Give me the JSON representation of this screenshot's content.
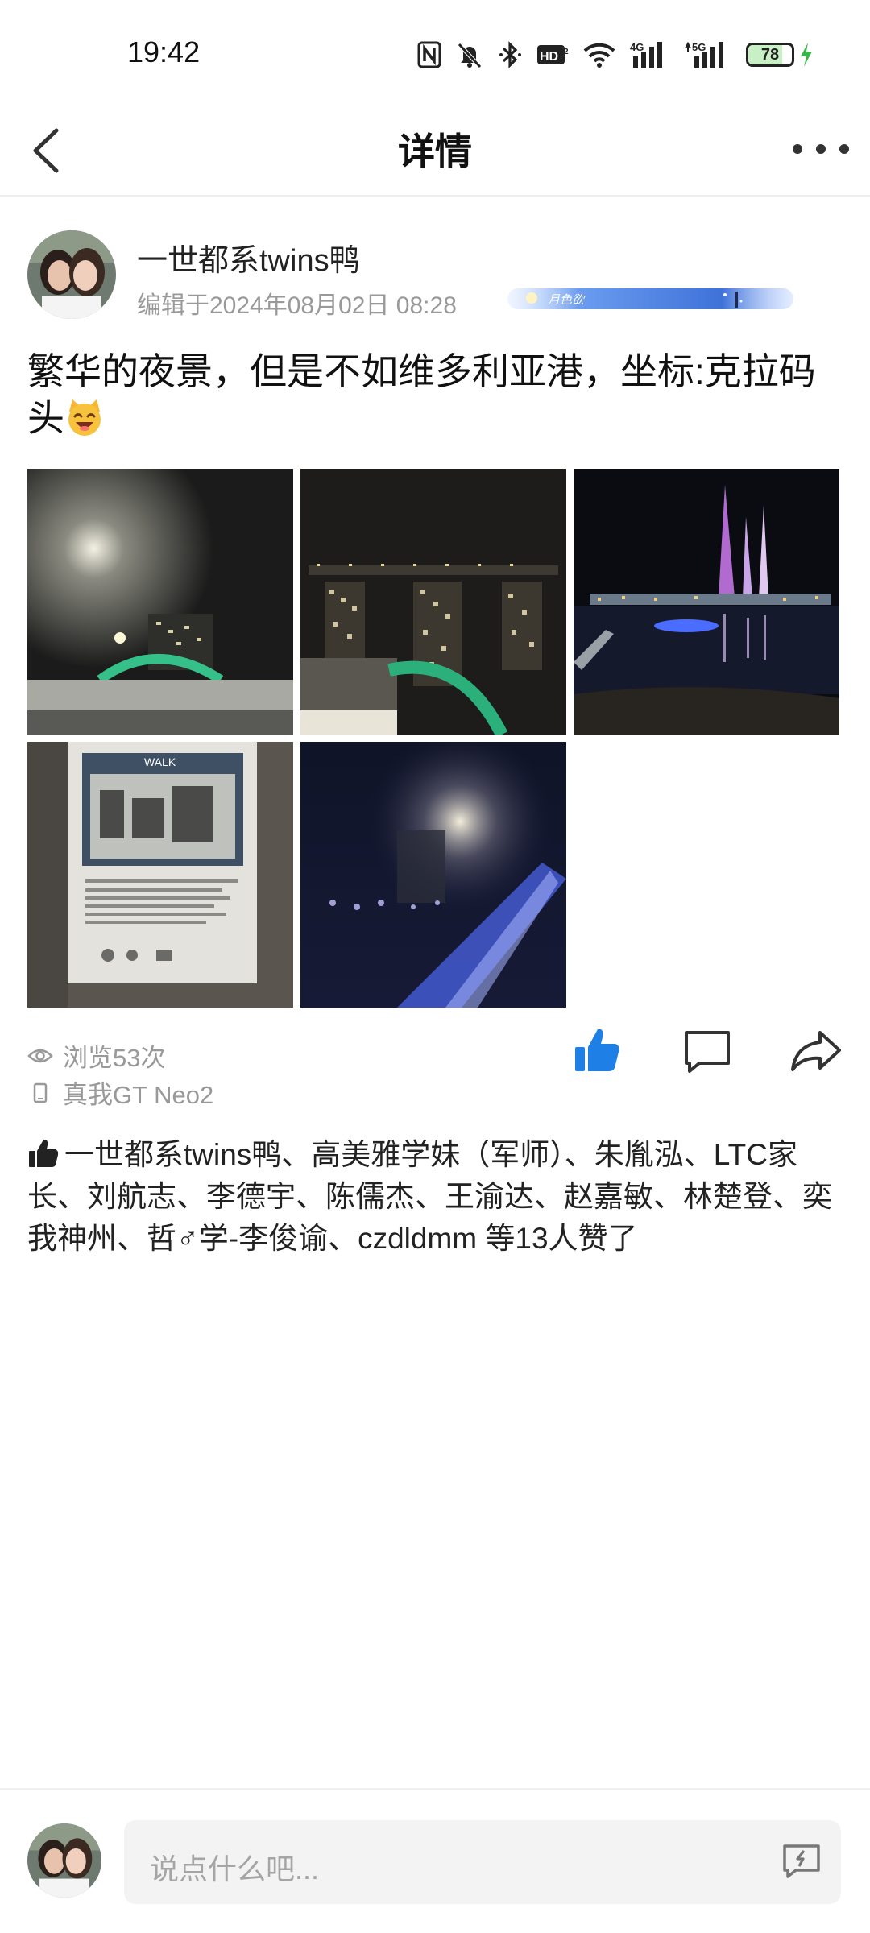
{
  "status_bar": {
    "time": "19:42",
    "battery": "78",
    "battery_level": 0.78,
    "icons": [
      "nfc-icon",
      "mute-bell-icon",
      "bluetooth-icon",
      "hd-icon",
      "wifi-icon",
      "4g-signal-icon",
      "5g-signal-icon",
      "battery-icon",
      "charging-icon"
    ]
  },
  "nav": {
    "title": "详情",
    "back_icon": "chevron-left-icon",
    "more_icon": "more-dots-icon"
  },
  "post": {
    "author": "一世都系twins鸭",
    "time": "编辑于2024年08月02日 08:28",
    "badge_text": "月色欲",
    "text": "繁华的夜景，但是不如维多利亚港，坐标:克拉码头",
    "emoji": "laughing-cat-emoji",
    "photos": [
      "photo-night-bridge",
      "photo-city-buildings",
      "photo-river-towers",
      "photo-wall-poster",
      "photo-blurred-lights"
    ],
    "poster_heading": "WALK",
    "views": "浏览53次",
    "device": "真我GT Neo2"
  },
  "likes": {
    "text": "一世都系twins鸭、高美雅学妹（军师）、朱胤泓、LTC家长、刘航志、李德宇、陈儒杰、王渝达、赵嘉敏、林楚登、奕我神州、哲♂学-李俊谕、czdldmm 等13人赞了"
  },
  "comment": {
    "placeholder": "说点什么吧..."
  },
  "colors": {
    "accent": "#1e7fe6",
    "muted": "#999999"
  }
}
